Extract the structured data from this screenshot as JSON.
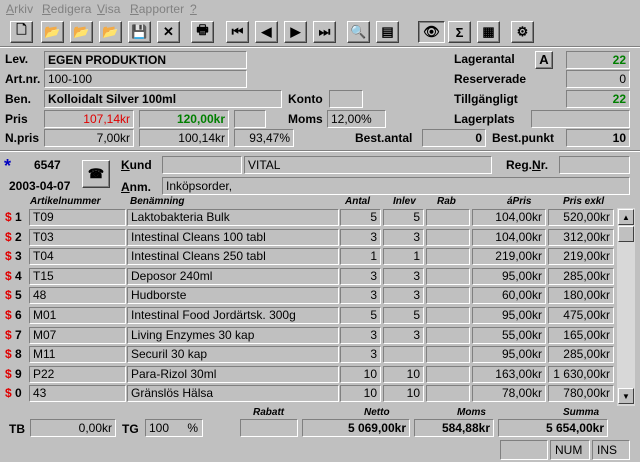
{
  "menu": [
    {
      "label": "Arkiv",
      "ul": "A",
      "rest": "rkiv"
    },
    {
      "label": "Redigera",
      "ul": "R",
      "rest": "edigera"
    },
    {
      "label": "Visa",
      "ul": "V",
      "rest": "isa"
    },
    {
      "label": "Rapporter",
      "ul": "R",
      "rest": "apporter"
    },
    {
      "label": "?",
      "ul": "?",
      "rest": ""
    }
  ],
  "toolbar": {
    "buttons": [
      "new-document-icon",
      "open-folder-icon",
      "open-folder-alt-icon",
      "open-folder-edit-icon",
      "save-icon",
      "delete-icon",
      "print-icon",
      "first-record-icon",
      "previous-record-icon",
      "next-record-icon",
      "last-record-icon",
      "print-preview-icon",
      "properties-icon",
      "view-eye-icon",
      "sum-icon",
      "table-icon",
      "settings-icon"
    ],
    "glyphs": [
      "🗋",
      "📂",
      "📂",
      "📂",
      "💾",
      "✕",
      "🖶",
      "⏮",
      "◀",
      "▶",
      "⏭",
      "🔍",
      "▤",
      "👁",
      "Σ",
      "▦",
      "⚙"
    ]
  },
  "product": {
    "lev_label": "Lev.",
    "lev_value": "EGEN PRODUKTION",
    "artnr_label": "Art.nr.",
    "artnr_value": "100-100",
    "ben_label": "Ben.",
    "ben_value": "Kolloidalt Silver 100ml",
    "konto_label": "Konto",
    "konto_value": "",
    "pris_label": "Pris",
    "pris_value_red": "107,14kr",
    "pris_value_green": "120,00kr",
    "moms_label": "Moms",
    "moms_value": "12,00%",
    "npris_label": "N.pris",
    "npris_value1": "7,00kr",
    "npris_value2": "100,14kr",
    "npris_pct": "93,47%",
    "best_antal_label": "Best.antal",
    "best_antal_value": "0",
    "best_punkt_label": "Best.punkt",
    "best_punkt_value": "10",
    "lagerantal_label": "Lagerantal",
    "a_button": "A",
    "lagerantal_value": "22",
    "reserverade_label": "Reserverade",
    "reserverade_value": "0",
    "tillgangligt_label": "Tillgängligt",
    "tillgangligt_value": "22",
    "lagerplats_label": "Lagerplats",
    "lagerplats_value": ""
  },
  "order": {
    "star": "*",
    "number": "6547",
    "date": "2003-04-07",
    "kund_label": "Kund",
    "kund_id": "",
    "kund_name": "VITAL",
    "regnr_label": "Reg.Nr.",
    "regnr_value": "",
    "anm_label": "Anm.",
    "anm_value": "Inköpsorder,"
  },
  "table": {
    "headers": {
      "artnr": "Artikelnummer",
      "ben": "Benämning",
      "antal": "Antal",
      "inlev": "Inlev",
      "rab": "Rab",
      "apris": "áPris",
      "prisexkl": "Pris exkl"
    },
    "rows": [
      {
        "key": "1",
        "artnr": "T09",
        "ben": "Laktobakteria Bulk",
        "antal": "5",
        "inlev": "5",
        "rab": "",
        "apris": "104,00kr",
        "prisexkl": "520,00kr"
      },
      {
        "key": "2",
        "artnr": "T03",
        "ben": "Intestinal Cleans 100 tabl",
        "antal": "3",
        "inlev": "3",
        "rab": "",
        "apris": "104,00kr",
        "prisexkl": "312,00kr"
      },
      {
        "key": "3",
        "artnr": "T04",
        "ben": "Intestinal Cleans 250 tabl",
        "antal": "1",
        "inlev": "1",
        "rab": "",
        "apris": "219,00kr",
        "prisexkl": "219,00kr"
      },
      {
        "key": "4",
        "artnr": "T15",
        "ben": "Deposor 240ml",
        "antal": "3",
        "inlev": "3",
        "rab": "",
        "apris": "95,00kr",
        "prisexkl": "285,00kr"
      },
      {
        "key": "5",
        "artnr": "48",
        "ben": "Hudborste",
        "antal": "3",
        "inlev": "3",
        "rab": "",
        "apris": "60,00kr",
        "prisexkl": "180,00kr"
      },
      {
        "key": "6",
        "artnr": "M01",
        "ben": "Intestinal Food Jordärtsk. 300g",
        "antal": "5",
        "inlev": "5",
        "rab": "",
        "apris": "95,00kr",
        "prisexkl": "475,00kr"
      },
      {
        "key": "7",
        "artnr": "M07",
        "ben": "Living Enzymes 30 kap",
        "antal": "3",
        "inlev": "3",
        "rab": "",
        "apris": "55,00kr",
        "prisexkl": "165,00kr"
      },
      {
        "key": "8",
        "artnr": "M11",
        "ben": "Securil 30 kap",
        "antal": "3",
        "inlev": "",
        "rab": "",
        "apris": "95,00kr",
        "prisexkl": "285,00kr"
      },
      {
        "key": "9",
        "artnr": "P22",
        "ben": "Para-Rizol 30ml",
        "antal": "10",
        "inlev": "10",
        "rab": "",
        "apris": "163,00kr",
        "prisexkl": "1 630,00kr"
      },
      {
        "key": "0",
        "artnr": "43",
        "ben": "Gränslös Hälsa",
        "antal": "10",
        "inlev": "10",
        "rab": "",
        "apris": "78,00kr",
        "prisexkl": "780,00kr"
      }
    ]
  },
  "totals": {
    "tb_label": "TB",
    "tb_value": "0,00kr",
    "tg_label": "TG",
    "tg_value": "100",
    "tg_unit": "%",
    "rabatt_label": "Rabatt",
    "rabatt_value": "",
    "netto_label": "Netto",
    "netto_value": "5 069,00kr",
    "moms_label": "Moms",
    "moms_value": "584,88kr",
    "summa_label": "Summa",
    "summa_value": "5 654,00kr"
  },
  "statusbar": {
    "num": "NUM",
    "ins": "INS"
  },
  "colors": {
    "red": "#e00000",
    "green": "#007f00",
    "star": "#0000c0"
  }
}
